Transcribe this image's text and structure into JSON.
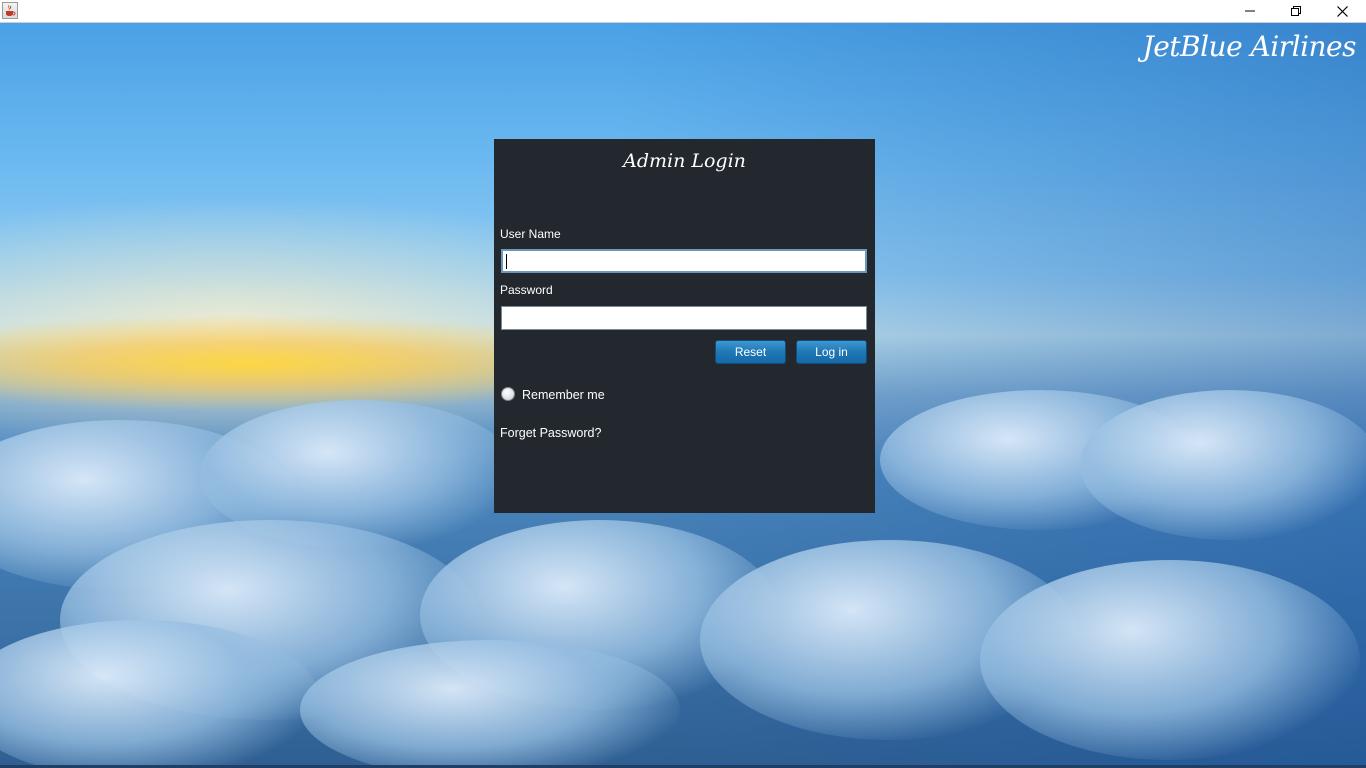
{
  "window": {
    "controls": {
      "minimize_icon": "minimize-icon",
      "maximize_icon": "restore-icon",
      "close_icon": "close-icon"
    },
    "app_icon": "java-cup-icon"
  },
  "brand": {
    "name": "JetBlue Airlines"
  },
  "login": {
    "title": "Admin Login",
    "username_label": "User Name",
    "username_value": "",
    "password_label": "Password",
    "password_value": "",
    "reset_label": "Reset",
    "login_label": "Log in",
    "remember_label": "Remember me",
    "remember_checked": false,
    "forgot_label": "Forget Password?"
  },
  "colors": {
    "panel_bg": "#22282e",
    "button_blue": "#1f78b6",
    "text": "#ffffff"
  }
}
